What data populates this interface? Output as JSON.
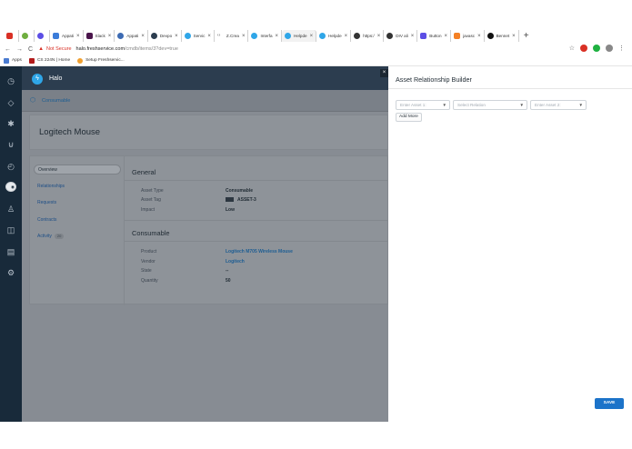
{
  "browser": {
    "tabs": [
      {
        "label": "Appati",
        "color": "#3b7cd9"
      },
      {
        "label": "Slack",
        "color": "#4a154b"
      },
      {
        "label": "Appati",
        "color": "#3d6bb3"
      },
      {
        "label": "Devpo",
        "color": "#2c3d4f"
      },
      {
        "label": "Servic",
        "color": "#2fa6e8"
      },
      {
        "label": "Z.Crea",
        "color": "#555555"
      },
      {
        "label": "Interfa",
        "color": "#2fa6e8"
      },
      {
        "label": "Helpde",
        "color": "#2fa6e8",
        "active": true
      },
      {
        "label": "Helpde",
        "color": "#2fa6e8"
      },
      {
        "label": "https:/",
        "color": "#333333"
      },
      {
        "label": "DIV ali",
        "color": "#333333"
      },
      {
        "label": "Button",
        "color": "#5c4ee5"
      },
      {
        "label": "javasc",
        "color": "#f48024"
      },
      {
        "label": "Bennet",
        "color": "#111111"
      }
    ],
    "new_tab": "+",
    "nav": {
      "back": "←",
      "forward": "→",
      "reload": "C"
    },
    "security": "Not Secure",
    "url_host": "halo.freshservice.com",
    "url_path": "/cmdb/items/3?dev=true",
    "bookmarks": [
      {
        "label": "Apps",
        "color": "#4a7bd0"
      },
      {
        "label": "CS 224N | Home",
        "color": "#b31b1b"
      },
      {
        "label": "Setup Freshservic...",
        "color": "#f0a030"
      }
    ]
  },
  "app": {
    "name": "Halo",
    "breadcrumb": "Consumable",
    "asset_title": "Logitech Mouse",
    "nav_tabs": [
      {
        "label": "Overview",
        "active": true
      },
      {
        "label": "Relationships"
      },
      {
        "label": "Requests"
      },
      {
        "label": "Contracts"
      },
      {
        "label": "Activity",
        "count": "20"
      }
    ],
    "general": {
      "title": "General",
      "rows": [
        {
          "label": "Asset Type",
          "value": "Consumable"
        },
        {
          "label": "Asset Tag",
          "value": "ASSET-3"
        },
        {
          "label": "Impact",
          "value": "Low"
        }
      ]
    },
    "consumable": {
      "title": "Consumable",
      "rows": [
        {
          "label": "Product",
          "value": "Logitech M705 Wireless Mouse"
        },
        {
          "label": "Vendor",
          "value": "Logitech"
        },
        {
          "label": "State",
          "value": "--"
        },
        {
          "label": "Quantity",
          "value": "50"
        }
      ]
    }
  },
  "panel": {
    "title": "Asset Relationship Builder",
    "close": "×",
    "asset1_placeholder": "Enter Asset 1:",
    "relation_placeholder": "Select Relation",
    "asset2_placeholder": "Enter Asset 2:",
    "add_more": "Add More",
    "save": "SAVE"
  }
}
